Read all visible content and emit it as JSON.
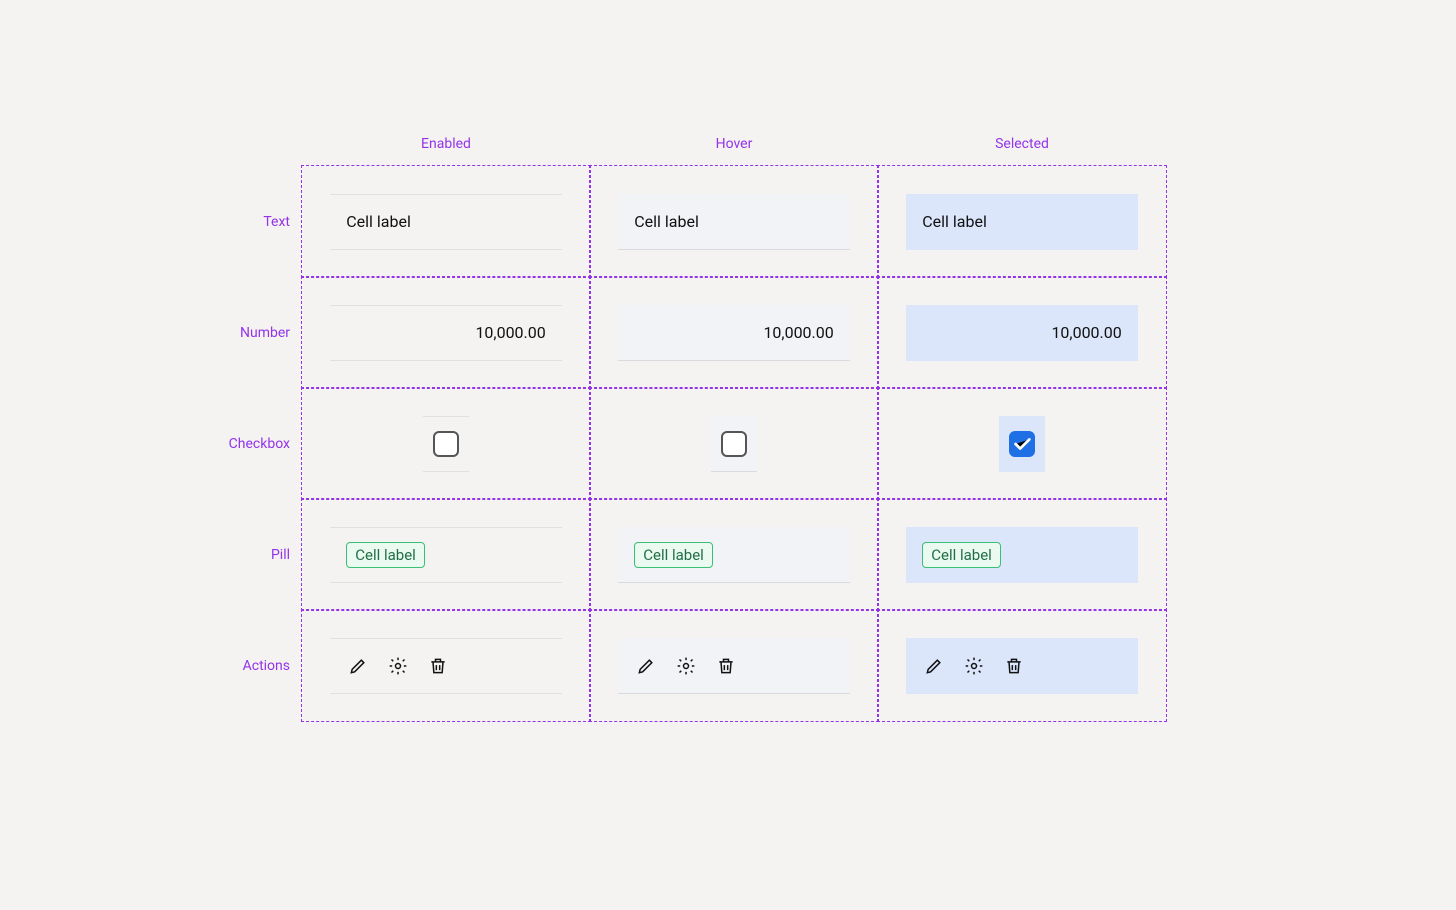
{
  "states": {
    "enabled": "Enabled",
    "hover": "Hover",
    "selected": "Selected"
  },
  "rows": {
    "text": "Text",
    "number": "Number",
    "checkbox": "Checkbox",
    "pill": "Pill",
    "actions": "Actions"
  },
  "text_cell": {
    "label": "Cell label"
  },
  "number_cell": {
    "value": "10,000.00"
  },
  "pill_cell": {
    "label": "Cell label"
  },
  "checkbox": {
    "checked_in_selected": true
  },
  "action_icons": {
    "edit": "edit-icon",
    "gear": "gear-icon",
    "trash": "trash-icon"
  }
}
